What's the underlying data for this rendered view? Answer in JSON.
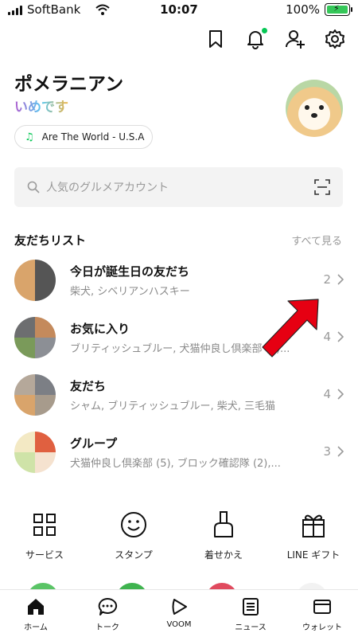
{
  "status_bar": {
    "carrier": "SoftBank",
    "time": "10:07",
    "battery": "100%"
  },
  "profile": {
    "name": "ポメラニアン",
    "status_message": "いめです",
    "music": "Are The World - U.S.A"
  },
  "search": {
    "placeholder": "人気のグルメアカウント"
  },
  "friends": {
    "section_title": "友だちリスト",
    "see_all": "すべて見る",
    "rows": [
      {
        "title": "今日が誕生日の友だち",
        "subtitle": "柴犬, シベリアンハスキー",
        "count": "2"
      },
      {
        "title": "お気に入り",
        "subtitle": "ブリティッシュブルー, 犬猫仲良し倶楽部 (5)...",
        "count": "4"
      },
      {
        "title": "友だち",
        "subtitle": "シャム, ブリティッシュブルー, 柴犬, 三毛猫",
        "count": "4"
      },
      {
        "title": "グループ",
        "subtitle": "犬猫仲良し倶楽部 (5), ブロック確認隊 (2),...",
        "count": "3"
      }
    ]
  },
  "services": [
    {
      "label": "サービス",
      "icon": "grid-icon"
    },
    {
      "label": "スタンプ",
      "icon": "smiley-icon"
    },
    {
      "label": "着せかえ",
      "icon": "brush-icon"
    },
    {
      "label": "LINE ギフト",
      "icon": "gift-icon"
    }
  ],
  "bottom_nav": [
    {
      "label": "ホーム",
      "icon": "home-icon"
    },
    {
      "label": "トーク",
      "icon": "chat-icon"
    },
    {
      "label": "VOOM",
      "icon": "voom-icon"
    },
    {
      "label": "ニュース",
      "icon": "news-icon"
    },
    {
      "label": "ウォレット",
      "icon": "wallet-icon"
    }
  ],
  "colors": {
    "accent": "#06c755",
    "annotation_arrow": "#e60012"
  }
}
